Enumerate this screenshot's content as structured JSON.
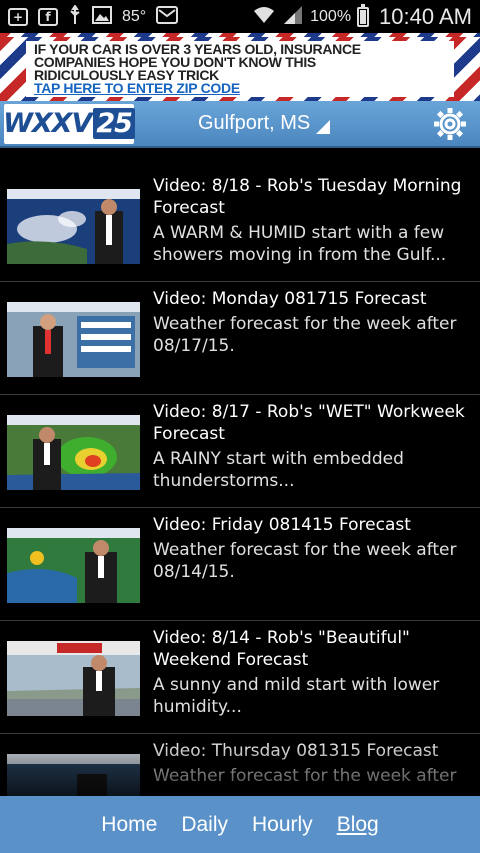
{
  "status_bar": {
    "temperature": "85°",
    "battery_percent": "100%",
    "battery_level": 1.0,
    "time": "10:40 AM",
    "icons": [
      "add-icon",
      "facebook-icon",
      "usb-icon",
      "image-icon",
      "weather-icon",
      "mail-icon",
      "wifi-icon",
      "signal-icon",
      "battery-icon"
    ]
  },
  "ad": {
    "lines": [
      "IF YOUR CAR IS OVER 3 YEARS OLD, INSURANCE",
      "COMPANIES HOPE YOU DON'T KNOW THIS",
      "RIDICULOUSLY EASY TRICK"
    ],
    "link": "TAP HERE TO ENTER ZIP CODE"
  },
  "header": {
    "logo_text": "WXXV",
    "logo_number": "25",
    "location": "Gulfport, MS",
    "settings_icon": "gear-icon"
  },
  "videos": [
    {
      "title": "Video: 8/18 - Rob's Tuesday Morning Forecast",
      "description": "A WARM & HUMID start with a few showers moving in from the Gulf..."
    },
    {
      "title": "Video: Monday 081715 Forecast",
      "description": "Weather forecast for the week after 08/17/15."
    },
    {
      "title": "Video: 8/17 - Rob's \"WET\" Workweek Forecast",
      "description": "A RAINY start with embedded thunderstorms..."
    },
    {
      "title": "Video: Friday 081415 Forecast",
      "description": "Weather forecast for the week after 08/14/15."
    },
    {
      "title": "Video: 8/14 - Rob's \"Beautiful\" Weekend Forecast",
      "description": "A sunny and mild start with lower humidity..."
    },
    {
      "title": "Video: Thursday 081315 Forecast",
      "description": "Weather forecast for the week after"
    }
  ],
  "nav": {
    "home": "Home",
    "daily": "Daily",
    "hourly": "Hourly",
    "blog": "Blog",
    "active": "blog"
  },
  "colors": {
    "header_blue": "#5b91c9",
    "logo_blue": "#1e4f95"
  }
}
